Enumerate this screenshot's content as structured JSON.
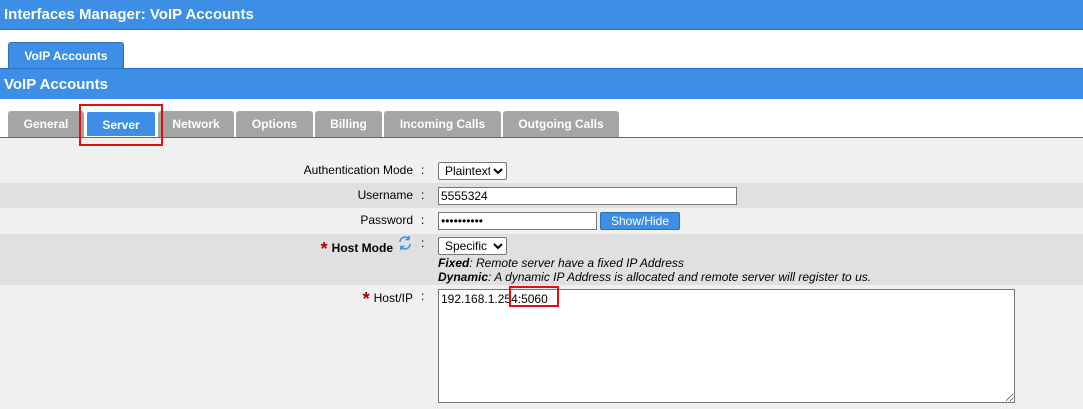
{
  "header": {
    "title": "Interfaces Manager:  VoIP Accounts"
  },
  "main_tab": {
    "label": "VoIP Accounts"
  },
  "section": {
    "title": "VoIP Accounts"
  },
  "sub_tabs": [
    "General",
    "Server",
    "Network",
    "Options",
    "Billing",
    "Incoming Calls",
    "Outgoing Calls"
  ],
  "active_sub_tab": "Server",
  "form": {
    "auth_mode": {
      "label": "Authentication Mode",
      "value": "Plaintext"
    },
    "username": {
      "label": "Username",
      "value": "5555324"
    },
    "password": {
      "label": "Password",
      "value": "••••••••••",
      "show_hide": "Show/Hide"
    },
    "host_mode": {
      "label": "Host Mode",
      "value": "Specific",
      "fixed_term": "Fixed",
      "fixed_desc": ": Remote server have a fixed IP Address",
      "dynamic_term": "Dynamic",
      "dynamic_desc": ": A dynamic IP Address is allocated and remote server will register to us."
    },
    "host_ip": {
      "label": "Host/IP",
      "value": "192.168.1.254:5060"
    },
    "colon": ":",
    "required_mark": "*"
  },
  "colors": {
    "accent": "#3d8fe6",
    "tab_inactive": "#a5a5a5",
    "highlight": "#e01010",
    "required": "#b00000"
  },
  "icons": {
    "host_mode_refresh": "refresh-icon"
  }
}
